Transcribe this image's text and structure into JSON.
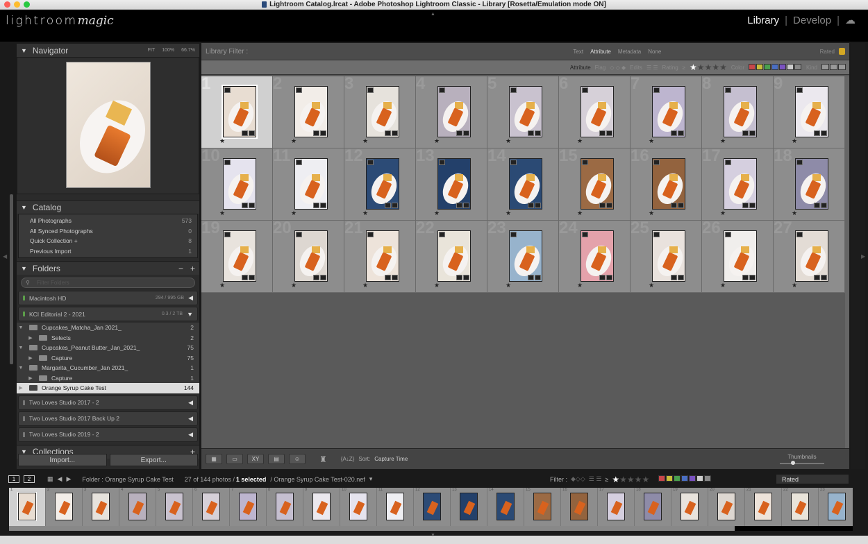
{
  "window": {
    "title": "Lightroom Catalog.lrcat - Adobe Photoshop Lightroom Classic - Library [Rosetta/Emulation mode ON]"
  },
  "identity": {
    "logo_plain": "lightroom",
    "logo_script": "magic",
    "modules": [
      "Library",
      "Develop"
    ],
    "active_module": "Library",
    "cloud_icon": "cloud-icon"
  },
  "navigator": {
    "title": "Navigator",
    "zoom_options": [
      "FIT",
      "100%",
      "66.7%"
    ]
  },
  "catalog": {
    "title": "Catalog",
    "items": [
      {
        "label": "All Photographs",
        "count": "573"
      },
      {
        "label": "All Synced Photographs",
        "count": "0"
      },
      {
        "label": "Quick Collection  +",
        "count": "8"
      },
      {
        "label": "Previous Import",
        "count": "1"
      }
    ]
  },
  "folders": {
    "title": "Folders",
    "search_placeholder": "Filter Folders",
    "volumes": [
      {
        "name": "Macintosh HD",
        "size": "294 / 995 GB",
        "online": true
      },
      {
        "name": "KCI Editorial 2 - 2021",
        "size": "0.3 / 2 TB",
        "online": true
      }
    ],
    "tree": [
      {
        "name": "Cupcakes_Matcha_Jan 2021_",
        "count": "2",
        "level": 1,
        "expanded": true
      },
      {
        "name": "Selects",
        "count": "2",
        "level": 2
      },
      {
        "name": "Cupcakes_Peanut Butter_Jan_2021_",
        "count": "75",
        "level": 1,
        "expanded": true
      },
      {
        "name": "Capture",
        "count": "75",
        "level": 2
      },
      {
        "name": "Margarita_Cucumber_Jan 2021_",
        "count": "1",
        "level": 1,
        "expanded": true
      },
      {
        "name": "Capture",
        "count": "1",
        "level": 2
      },
      {
        "name": "Orange Syrup Cake Test",
        "count": "144",
        "level": 1,
        "selected": true
      }
    ],
    "offline_volumes": [
      "Two Loves Studio 2017 - 2",
      "Two Loves Studio 2017 Back Up 2",
      "Two Loves Studio 2019 - 2"
    ]
  },
  "collections": {
    "title": "Collections"
  },
  "buttons": {
    "import": "Import...",
    "export": "Export..."
  },
  "library_filter": {
    "label": "Library Filter :",
    "tabs": [
      "Text",
      "Attribute",
      "Metadata",
      "None"
    ],
    "active_tab": "Attribute",
    "preset": "Rated",
    "attribute_label": "Attribute",
    "flag_label": "Flag",
    "edits_label": "Edits",
    "rating_label": "Rating",
    "rating_op": "≥",
    "rating_value": 1,
    "color_label": "Color",
    "kind_label": "Kind",
    "colors": [
      "#c8474a",
      "#c9bd3a",
      "#4aa04e",
      "#4a6ec2",
      "#7a52c0",
      "#cccccc",
      "#888888"
    ]
  },
  "grid": {
    "selected": 1,
    "cells": [
      {
        "n": "1",
        "bg": "#e8ddd2"
      },
      {
        "n": "2",
        "bg": "#f2ede8"
      },
      {
        "n": "3",
        "bg": "#e6e2dc"
      },
      {
        "n": "4",
        "bg": "#b8b0bd"
      },
      {
        "n": "5",
        "bg": "#c9c2cf"
      },
      {
        "n": "6",
        "bg": "#d6d0d8"
      },
      {
        "n": "7",
        "bg": "#bdb5cf"
      },
      {
        "n": "8",
        "bg": "#c5bfd0"
      },
      {
        "n": "9",
        "bg": "#ebe8ee"
      },
      {
        "n": "10",
        "bg": "#e5e3ee"
      },
      {
        "n": "11",
        "bg": "#eeeef2"
      },
      {
        "n": "12",
        "bg": "#2c4b76"
      },
      {
        "n": "13",
        "bg": "#23406a"
      },
      {
        "n": "14",
        "bg": "#2b4a74"
      },
      {
        "n": "15",
        "bg": "#9b6a44"
      },
      {
        "n": "16",
        "bg": "#93633e"
      },
      {
        "n": "17",
        "bg": "#d5cfdf"
      },
      {
        "n": "18",
        "bg": "#8e8ba8"
      },
      {
        "n": "19",
        "bg": "#e8e3dd"
      },
      {
        "n": "20",
        "bg": "#ddd7d1"
      },
      {
        "n": "21",
        "bg": "#ede3da"
      },
      {
        "n": "22",
        "bg": "#e9e4da"
      },
      {
        "n": "23",
        "bg": "#97b3cc"
      },
      {
        "n": "24",
        "bg": "#e4a2ab"
      },
      {
        "n": "25",
        "bg": "#e9e2dd"
      },
      {
        "n": "26",
        "bg": "#f0eeec"
      },
      {
        "n": "27",
        "bg": "#e3dcd5"
      }
    ],
    "rating_star": "★"
  },
  "toolbar": {
    "sort_label": "Sort:",
    "sort_value": "Capture Time",
    "thumbnails_label": "Thumbnails",
    "thumbnail_size": 0.3
  },
  "filmstrip": {
    "pages": [
      "1",
      "2"
    ],
    "source": "Folder : Orange Syrup Cake Test",
    "count_text": "27 of 144 photos /",
    "selected_text": "1 selected",
    "file_text": "/ Orange Syrup Cake Test-020.nef",
    "filter_label": "Filter :",
    "rated_value": "Rated",
    "frames": [
      "1",
      "2",
      "3",
      "4",
      "5",
      "6",
      "7",
      "8",
      "9",
      "10",
      "11",
      "12",
      "13",
      "14",
      "15",
      "16",
      "17",
      "18",
      "19",
      "20",
      "21",
      "22",
      "23"
    ]
  }
}
